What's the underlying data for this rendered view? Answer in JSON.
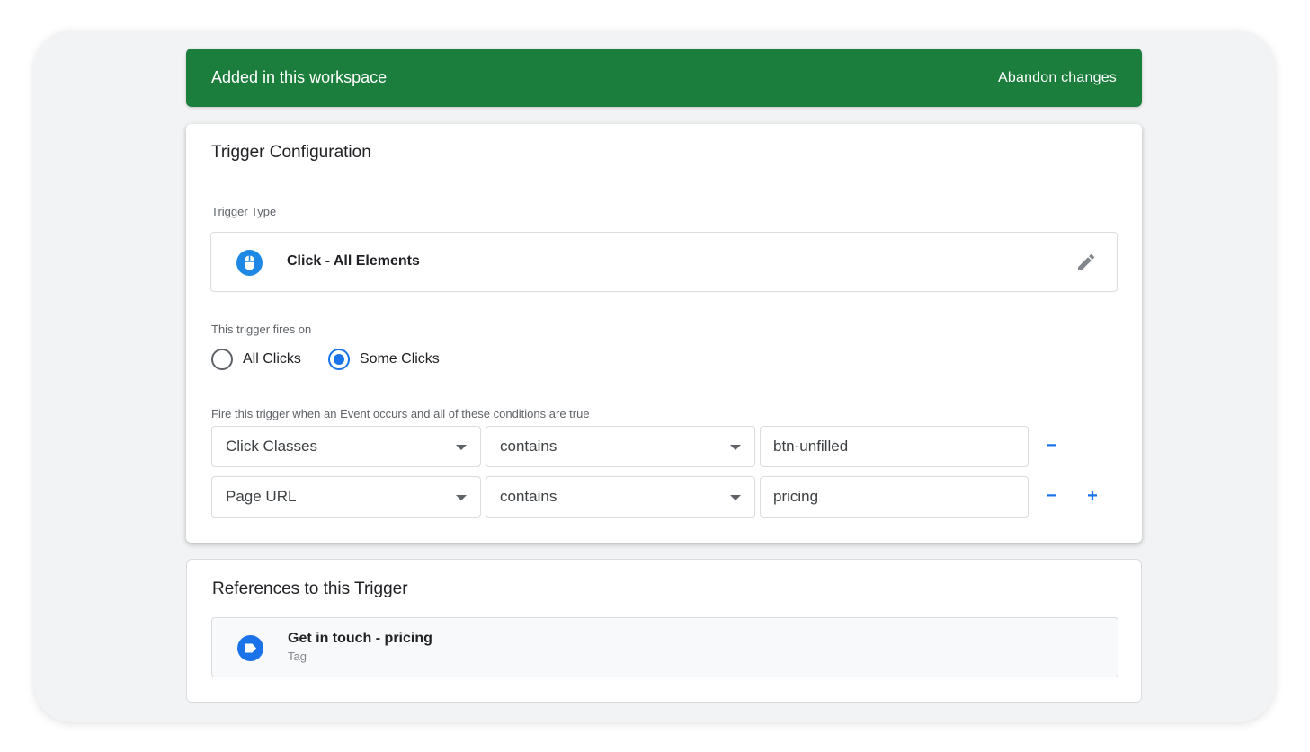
{
  "banner": {
    "title": "Added in this workspace",
    "action": "Abandon changes",
    "color": "#1b7e3c"
  },
  "config": {
    "title": "Trigger Configuration",
    "trigger_type_label": "Trigger Type",
    "trigger_type": {
      "name": "Click - All Elements",
      "icon": "mouse-icon"
    },
    "fires_on_label": "This trigger fires on",
    "fires_on_options": [
      {
        "label": "All Clicks",
        "checked": false
      },
      {
        "label": "Some Clicks",
        "checked": true
      }
    ],
    "conditions_label": "Fire this trigger when an Event occurs and all of these conditions are true",
    "conditions": [
      {
        "variable": "Click Classes",
        "operator": "contains",
        "value": "btn-unfilled"
      },
      {
        "variable": "Page URL",
        "operator": "contains",
        "value": "pricing"
      }
    ],
    "remove_label": "−",
    "add_label": "+"
  },
  "references": {
    "title": "References to this Trigger",
    "items": [
      {
        "name": "Get in touch - pricing",
        "type": "Tag",
        "icon": "tag-icon"
      }
    ]
  },
  "colors": {
    "accent": "#1a73e8",
    "trigger_icon": "#1e88e5"
  }
}
